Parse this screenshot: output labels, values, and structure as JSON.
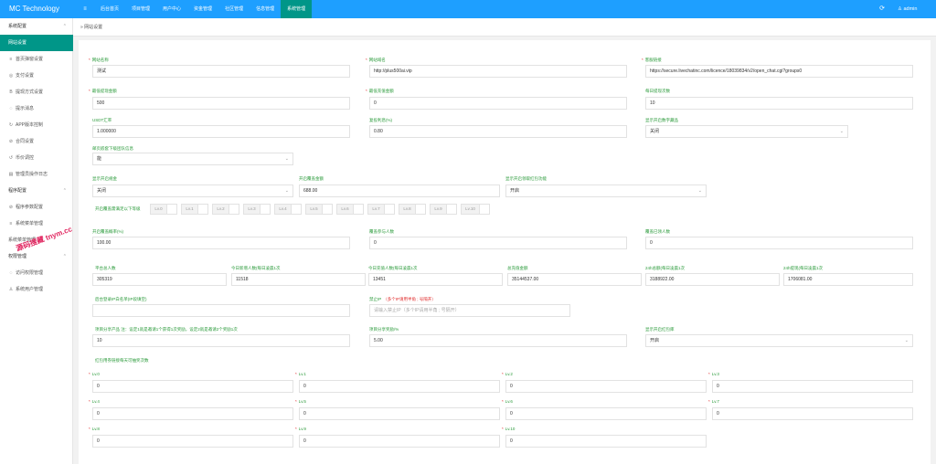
{
  "header": {
    "logo": "MC Technology",
    "menu_icon": "≡",
    "nav": [
      "后台首页",
      "项目管理",
      "用户中心",
      "资金管理",
      "社区管理",
      "信息管理",
      "系统管理"
    ],
    "refresh_icon": "refresh-icon",
    "user": "admin"
  },
  "sidebar": {
    "items": [
      {
        "label": "系统配置",
        "type": "group"
      },
      {
        "label": "网站设置",
        "type": "active"
      },
      {
        "label": "首页弹窗设置",
        "type": "sub",
        "icon": "≡"
      },
      {
        "label": "支付设置",
        "type": "sub",
        "icon": "◎"
      },
      {
        "label": "提现方式设置",
        "type": "sub",
        "icon": "B"
      },
      {
        "label": "提示消息",
        "type": "sub",
        "icon": "◌"
      },
      {
        "label": "APP版本控制",
        "type": "sub",
        "icon": "↻"
      },
      {
        "label": "合同设置",
        "type": "sub",
        "icon": "⊘"
      },
      {
        "label": "币价调控",
        "type": "sub",
        "icon": "↺"
      },
      {
        "label": "管理员操作日志",
        "type": "sub",
        "icon": "▤"
      },
      {
        "label": "程序配置",
        "type": "group"
      },
      {
        "label": "程序参数配置",
        "type": "sub",
        "icon": "⊘"
      },
      {
        "label": "系统菜单管理",
        "type": "sub",
        "icon": "≡"
      },
      {
        "label": "系统菜单管理",
        "type": "sub",
        "icon": ""
      },
      {
        "label": "权限管理",
        "type": "group"
      },
      {
        "label": "访问权限管理",
        "type": "sub",
        "icon": "◌"
      },
      {
        "label": "系统用户管理",
        "type": "sub",
        "icon": "♙"
      }
    ],
    "watermark": "源码搜藏 tnym.cc"
  },
  "breadcrumb": "网站设置",
  "form": {
    "site_name": {
      "label": "网站名称",
      "value": "测试"
    },
    "site_domain": {
      "label": "网站域名",
      "value": "http://plus500ai.vip"
    },
    "service_link": {
      "label": "客服链接",
      "value": "https://secure.livechatinc.com/licence/18039834/v2/open_chat.cgi?groups0"
    },
    "min_withdraw": {
      "label": "最低提现金额",
      "value": "500"
    },
    "min_recharge": {
      "label": "最低充值金额",
      "value": "0"
    },
    "daily_withdraw_times": {
      "label": "每日提现次数",
      "value": "10"
    },
    "usdt_rate": {
      "label": "USDT汇率",
      "value": "1.000000"
    },
    "fee_rate": {
      "label": "复投利息(%)",
      "value": "0.80"
    },
    "show_digital_currency": {
      "label": "显示开启数字藏品",
      "value": "关闭"
    },
    "show_below_team": {
      "label": "邮页嵌套下级团队信息",
      "value": "能"
    },
    "show_scale_award": {
      "label": "显示开启规金",
      "value": "关闭"
    },
    "scale_award_amount": {
      "label": "开启覆盖金额",
      "value": "688.00"
    },
    "show_fund_redpacket": {
      "label": "显示开启领取红包功能",
      "value": "开启"
    },
    "levels_label": "开启覆盖需满足以下等级",
    "level_tags": [
      "Lv.0",
      "Lv.1",
      "Lv.2",
      "Lv.3",
      "Lv.4",
      "Lv.5",
      "Lv.6",
      "Lv.7",
      "Lv.8",
      "Lv.9",
      "Lv.10"
    ],
    "award_ratio": {
      "label": "开启覆盖概率(%)",
      "value": "100.00"
    },
    "award_participants": {
      "label": "覆盖参与人数",
      "value": "0"
    },
    "award_received": {
      "label": "覆盖已领人数",
      "value": "0"
    },
    "stats": [
      {
        "label": "平台总人数",
        "value": "305319"
      },
      {
        "label": "今日新增人数(每日凌晨1次",
        "value": "11518"
      },
      {
        "label": "今日充值人数(每日凌晨1次",
        "value": "13451"
      },
      {
        "label": "总充值金额",
        "value": "35144537.00"
      },
      {
        "label": "24h总额(每日凌晨1次",
        "value": "3188922.00"
      },
      {
        "label": "24h提现(每日凌晨1次",
        "value": "1706081.00"
      }
    ],
    "ip_blacklist": {
      "label": "后台登录IP白名单(IP段填空)",
      "value": ""
    },
    "forbid_ip": {
      "label": "禁止IP",
      "note": "（多个IP请用半角 ; 号隔开）",
      "placeholder": "请输入禁止IP（多个IP请用半角 ; 号隔开）"
    },
    "project_share": {
      "label": "项目分享产品 注：设定1就是邀请1个获得1次奖励，设定2就是邀请2个奖励1次",
      "value": "10"
    },
    "project_share_reward": {
      "label": "项目分享奖励/%",
      "value": "5.00"
    },
    "show_redpacket": {
      "label": "显示开启红包库",
      "value": "开启"
    },
    "redpacket_section": "红包用券链接每天可抽奖次数",
    "lv_inputs": [
      {
        "label": "Lv.0",
        "value": "0"
      },
      {
        "label": "Lv.1",
        "value": "0"
      },
      {
        "label": "Lv.2",
        "value": "0"
      },
      {
        "label": "Lv.3",
        "value": "0"
      },
      {
        "label": "Lv.4",
        "value": "0"
      },
      {
        "label": "Lv.5",
        "value": "0"
      },
      {
        "label": "Lv.6",
        "value": "0"
      },
      {
        "label": "Lv.7",
        "value": "0"
      },
      {
        "label": "Lv.8",
        "value": "0"
      },
      {
        "label": "Lv.9",
        "value": "0"
      },
      {
        "label": "Lv.10",
        "value": "0"
      }
    ]
  }
}
